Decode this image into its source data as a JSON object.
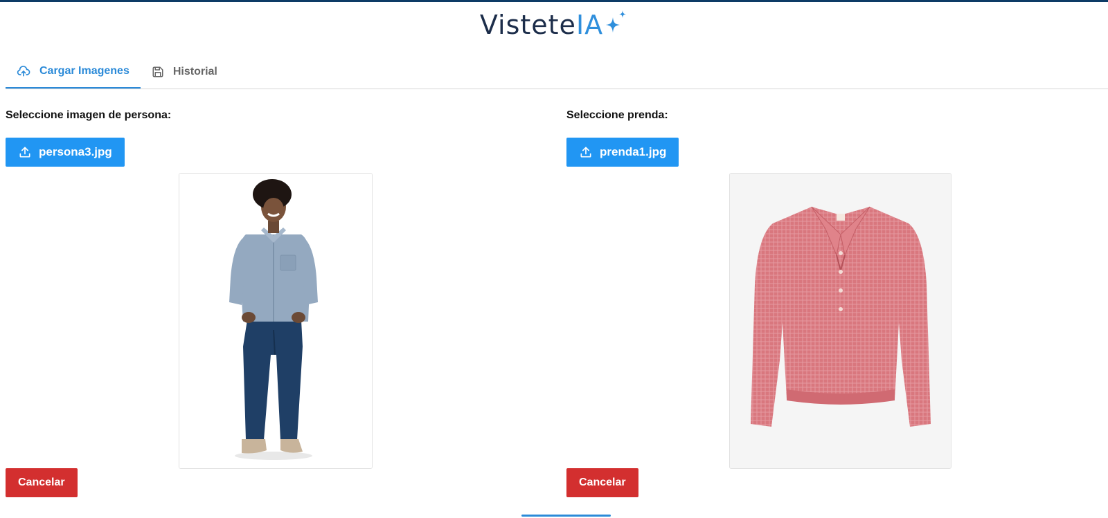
{
  "app": {
    "brand_main": "Vistete",
    "brand_accent": "IA",
    "accent_color": "#2196f3",
    "danger_color": "#d32f2f"
  },
  "tabs": [
    {
      "label": "Cargar Imagenes",
      "icon": "cloud-upload-icon",
      "active": true
    },
    {
      "label": "Historial",
      "icon": "save-icon",
      "active": false
    }
  ],
  "person_panel": {
    "label": "Seleccione imagen de persona:",
    "file_name": "persona3.jpg",
    "upload_icon": "upload-icon",
    "cancel_label": "Cancelar"
  },
  "garment_panel": {
    "label": "Seleccione prenda:",
    "file_name": "prenda1.jpg",
    "upload_icon": "upload-icon",
    "cancel_label": "Cancelar"
  }
}
